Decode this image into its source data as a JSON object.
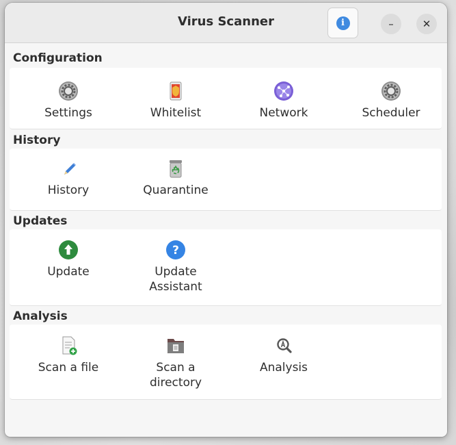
{
  "window": {
    "title": "Virus Scanner",
    "about_icon": "info-icon",
    "minimize_glyph": "–",
    "close_glyph": "✕"
  },
  "sections": {
    "configuration": {
      "title": "Configuration",
      "items": [
        {
          "label": "Settings",
          "icon": "gear-icon"
        },
        {
          "label": "Whitelist",
          "icon": "shield-list-icon"
        },
        {
          "label": "Network",
          "icon": "network-globe-icon"
        },
        {
          "label": "Scheduler",
          "icon": "gear-icon"
        }
      ]
    },
    "history": {
      "title": "History",
      "items": [
        {
          "label": "History",
          "icon": "pencil-icon"
        },
        {
          "label": "Quarantine",
          "icon": "recycle-bin-icon"
        }
      ]
    },
    "updates": {
      "title": "Updates",
      "items": [
        {
          "label": "Update",
          "icon": "up-arrow-icon"
        },
        {
          "label": "Update",
          "label2": "Assistant",
          "icon": "help-icon"
        }
      ]
    },
    "analysis": {
      "title": "Analysis",
      "items": [
        {
          "label": "Scan a file",
          "icon": "new-file-icon"
        },
        {
          "label": "Scan a",
          "label2": "directory",
          "icon": "folder-icon"
        },
        {
          "label": "Analysis",
          "icon": "magnifier-icon"
        }
      ]
    }
  },
  "colors": {
    "accent_blue": "#3f8ae0",
    "update_green": "#2e8b3e",
    "help_blue": "#3584e4"
  }
}
